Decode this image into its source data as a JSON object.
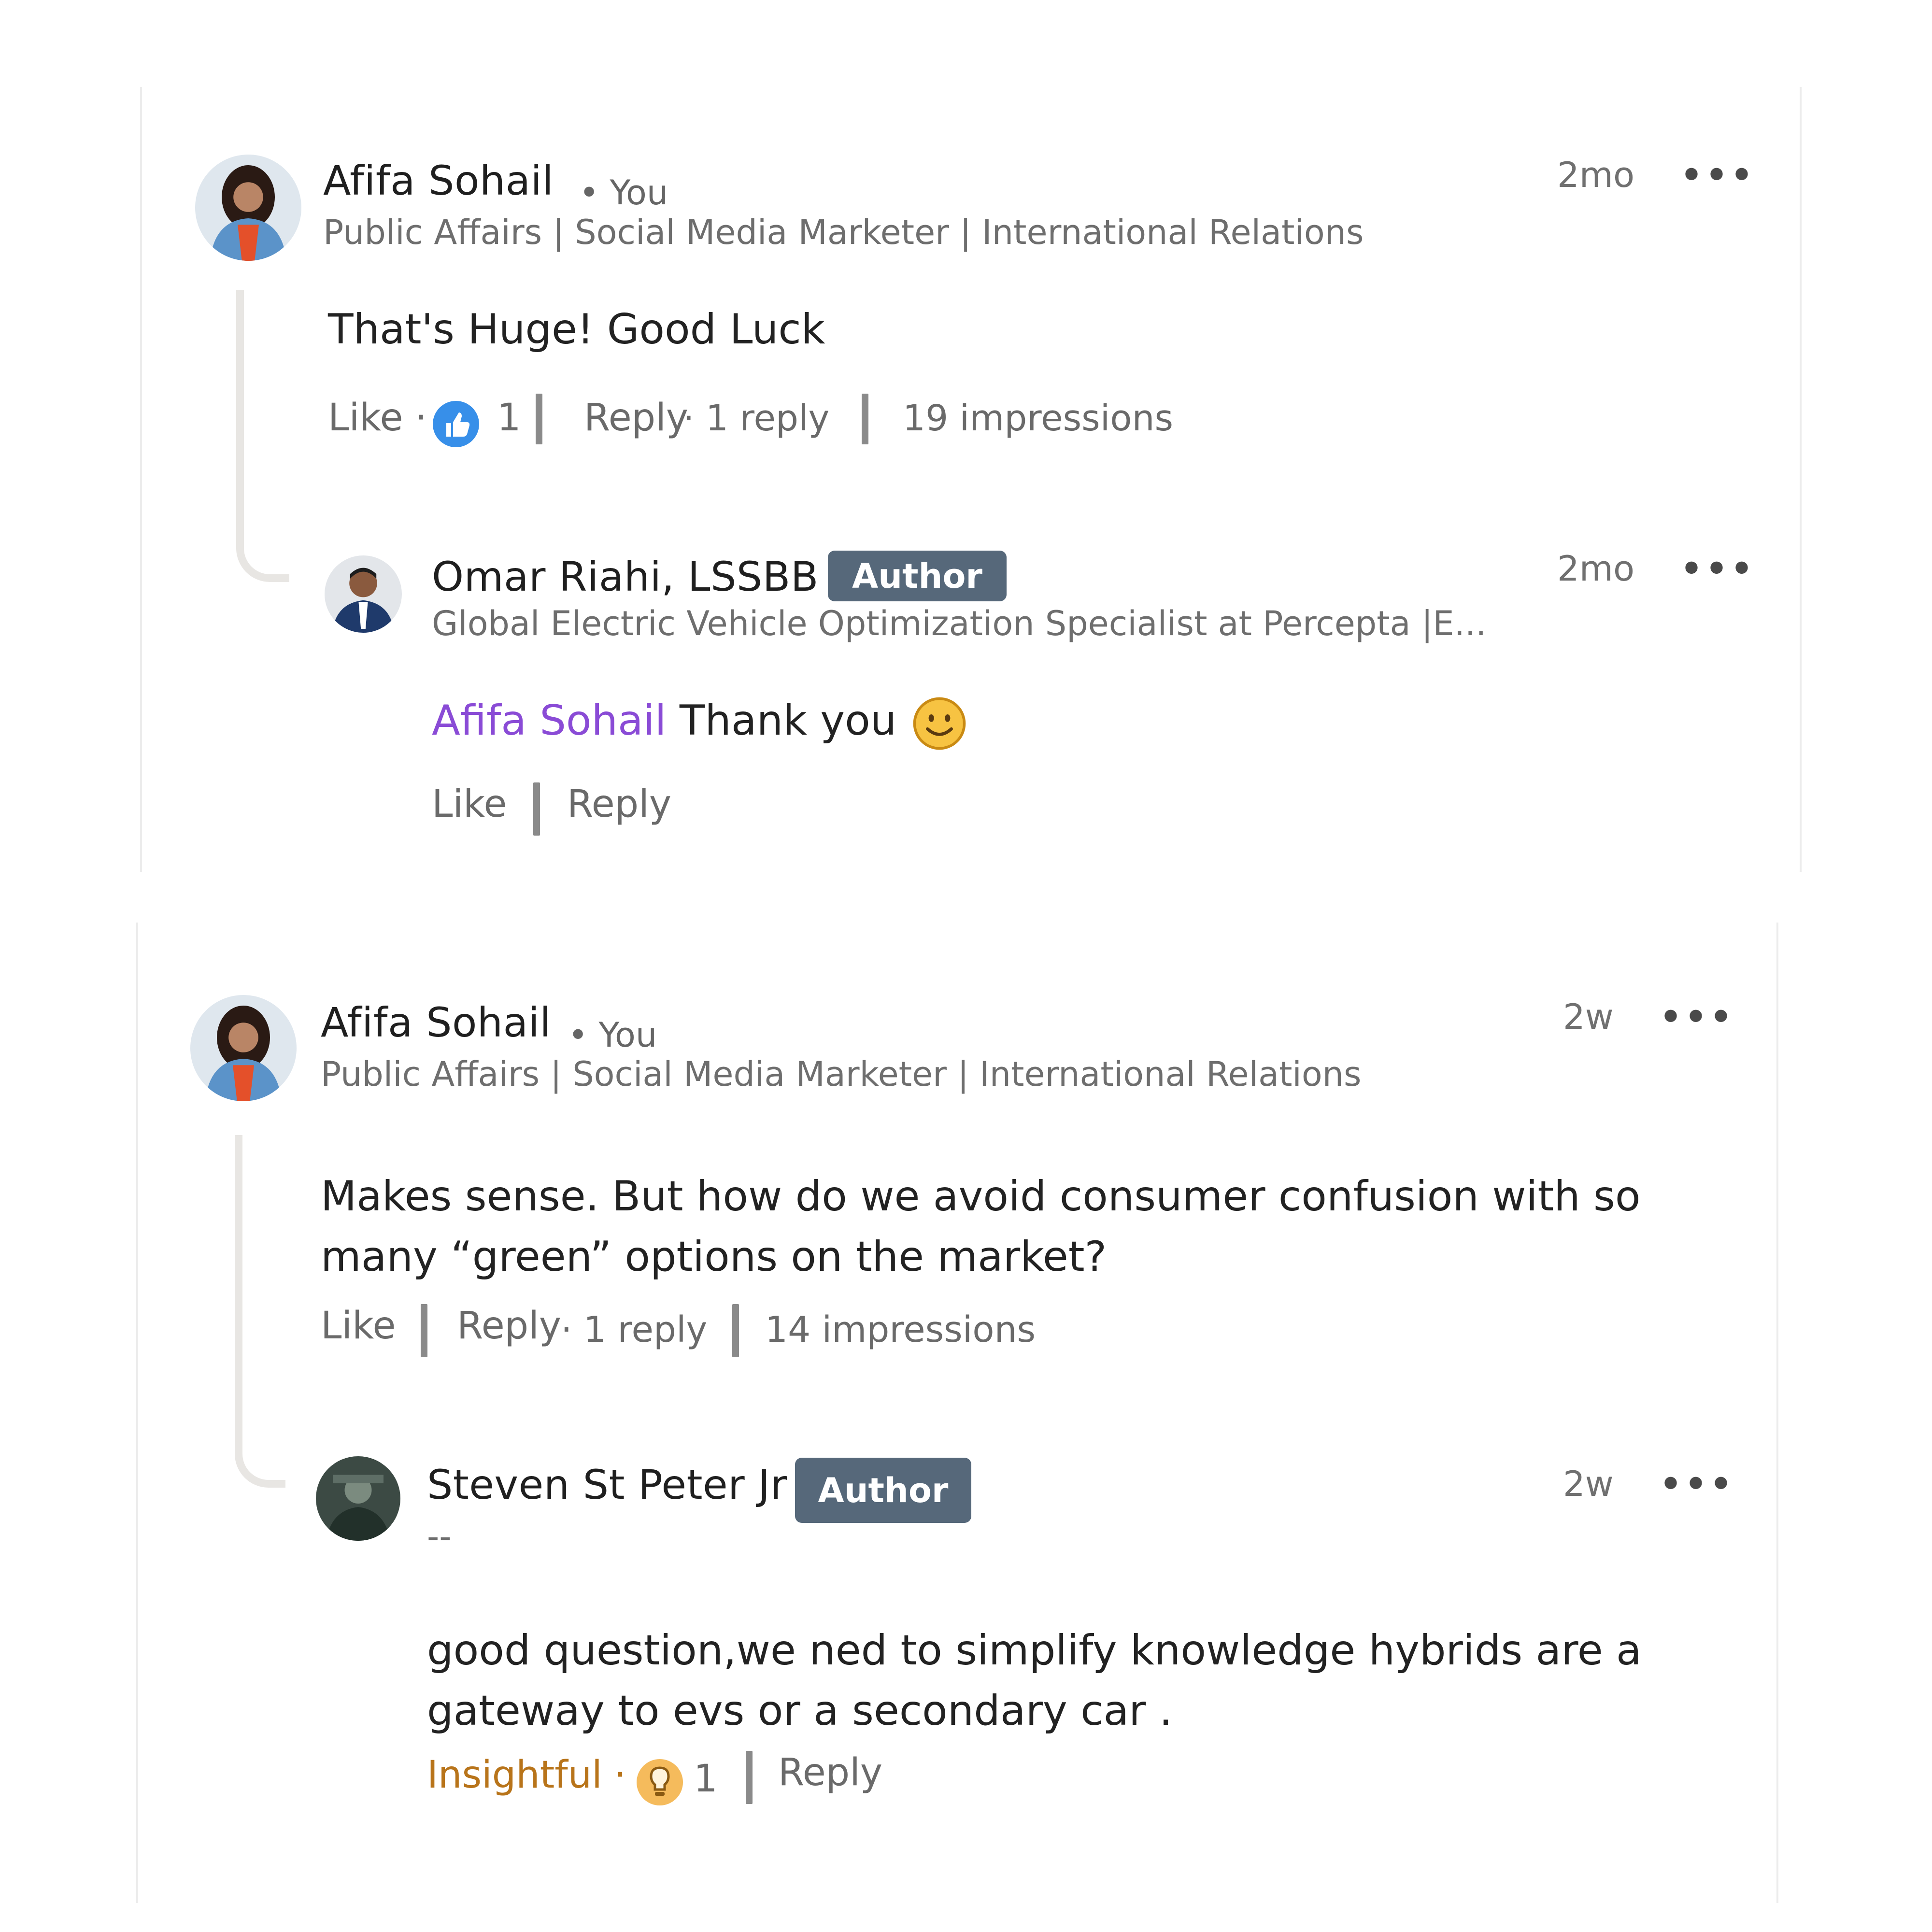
{
  "comment1": {
    "author": "Afifa Sohail",
    "you_label": "• You",
    "headline": "Public Affairs | Social Media Marketer | International Relations",
    "time": "2mo",
    "more": "•••",
    "text": "That's Huge! Good Luck",
    "like_label": "Like ·",
    "reaction_count": "1",
    "reply_label": "Reply",
    "reply_count": "· 1 reply",
    "impressions": "19 impressions",
    "reply": {
      "author": "Omar Riahi, LSSBB",
      "badge": "Author",
      "headline": "Global Electric Vehicle Optimization Specialist at Percepta |E...",
      "time": "2mo",
      "more": "•••",
      "mention": "Afifa Sohail",
      "text": "Thank you",
      "emoji": "smiling-face",
      "like_label": "Like",
      "reply_label": "Reply"
    }
  },
  "comment2": {
    "author": "Afifa Sohail",
    "you_label": "• You",
    "headline": "Public Affairs | Social Media Marketer | International Relations",
    "time": "2w",
    "more": "•••",
    "text": "Makes sense. But how do we avoid consumer confusion with so many “green” options on the market?",
    "like_label": "Like",
    "reply_label": "Reply",
    "reply_count": "· 1 reply",
    "impressions": "14 impressions",
    "reply": {
      "author": "Steven St Peter Jr",
      "badge": "Author",
      "headline": "--",
      "time": "2w",
      "more": "•••",
      "text": "good question,we ned to simplify knowledge hybrids are a gateway to evs or a secondary car .",
      "reaction_label": "Insightful ·",
      "reaction_count": "1",
      "reply_label": "Reply"
    }
  },
  "colors": {
    "mention": "#8a4bd6",
    "badge_bg": "#56687a",
    "like_blue": "#378fe9",
    "insightful": "#b8741a"
  }
}
